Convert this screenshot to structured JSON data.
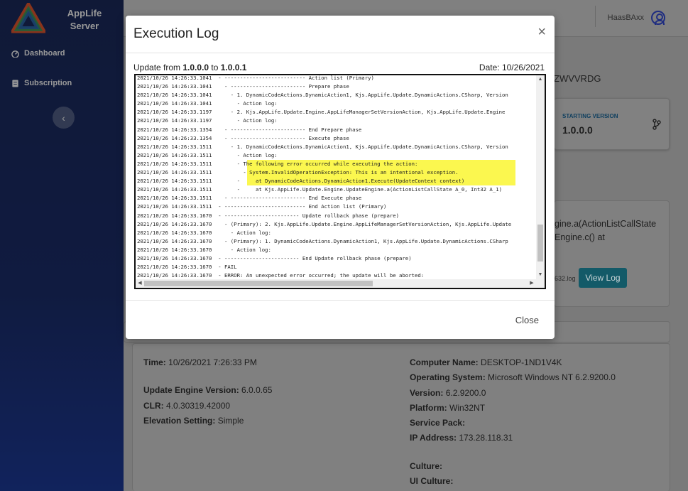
{
  "app": {
    "brand_line1": "AppLife",
    "brand_line2": "Server"
  },
  "sidebar": {
    "items": [
      {
        "label": "Dashboard",
        "icon": "dashboard-icon"
      },
      {
        "label": "Subscription",
        "icon": "subscription-icon"
      }
    ],
    "collapse_icon": "chevron-left-icon"
  },
  "header": {
    "user_name": "HaasBAxx",
    "user_icon": "user-circle-icon"
  },
  "background": {
    "id_partial": "ZWVVRDG",
    "starting_version_label": "STARTING VERSION",
    "starting_version_value": "1.0.0.0",
    "branch_icon": "branch-icon",
    "error_line1": "gine.a(ActionListCallState",
    "error_line2": "Engine.c() at",
    "log_file_partial": "632.log",
    "view_log_label": "View Log",
    "details_left": [
      {
        "key": "Time:",
        "value": "10/26/2021 7:26:33 PM"
      },
      {
        "key": "Update Engine Version:",
        "value": "6.0.0.65"
      },
      {
        "key": "CLR:",
        "value": "4.0.30319.42000"
      },
      {
        "key": "Elevation Setting:",
        "value": "Simple"
      }
    ],
    "details_right": [
      {
        "key": "Computer Name:",
        "value": "DESKTOP-1ND1V4K"
      },
      {
        "key": "Operating System:",
        "value": "Microsoft Windows NT 6.2.9200.0"
      },
      {
        "key": "Version:",
        "value": "6.2.9200.0"
      },
      {
        "key": "Platform:",
        "value": "Win32NT"
      },
      {
        "key": "Service Pack:",
        "value": ""
      },
      {
        "key": "IP Address:",
        "value": "173.28.118.31"
      },
      {
        "key": "Culture:",
        "value": ""
      },
      {
        "key": "UI Culture:",
        "value": ""
      }
    ]
  },
  "modal": {
    "title": "Execution Log",
    "close_icon": "close-icon",
    "update_prefix": "Update from ",
    "from_version": "1.0.0.0",
    "to_word": " to ",
    "to_version": "1.0.0.1",
    "date_text": "Date: 10/26/2021",
    "close_button_label": "Close",
    "highlight_color": "#fbf74f",
    "log_lines": [
      {
        "text": "2021/10/26 14:26:33.1041  - -------------------------- Action list (Primary)",
        "hl": false
      },
      {
        "text": "2021/10/26 14:26:33.1041    - ------------------------ Prepare phase",
        "hl": false
      },
      {
        "text": "2021/10/26 14:26:33.1041      - 1. DynamicCodeActions.DynamicAction1, Kjs.AppLife.Update.DynamicActions.CSharp, Version",
        "hl": false
      },
      {
        "text": "2021/10/26 14:26:33.1041        - Action log:",
        "hl": false
      },
      {
        "text": "2021/10/26 14:26:33.1197      - 2. Kjs.AppLife.Update.Engine.AppLifeManagerSetVersionAction, Kjs.AppLife.Update.Engine",
        "hl": false
      },
      {
        "text": "2021/10/26 14:26:33.1197        - Action log:",
        "hl": false
      },
      {
        "text": "2021/10/26 14:26:33.1354    - ------------------------ End Prepare phase",
        "hl": false
      },
      {
        "text": "2021/10/26 14:26:33.1354    - ------------------------ Execute phase",
        "hl": false
      },
      {
        "text": "2021/10/26 14:26:33.1511      - 1. DynamicCodeActions.DynamicAction1, Kjs.AppLife.Update.DynamicActions.CSharp, Version",
        "hl": false
      },
      {
        "text": "2021/10/26 14:26:33.1511        - Action log:",
        "hl": false
      },
      {
        "text": "2021/10/26 14:26:33.1511        - The following error occurred while executing the action:",
        "hl": true
      },
      {
        "text": "2021/10/26 14:26:33.1511          - System.InvalidOperationException: This is an intentional exception.",
        "hl": true
      },
      {
        "text": "2021/10/26 14:26:33.1511        -     at DynamicCodeActions.DynamicAction1.Execute(UpdateContext context)",
        "hl": true
      },
      {
        "text": "2021/10/26 14:26:33.1511        -     at Kjs.AppLife.Update.Engine.UpdateEngine.a(ActionListCallState A_0, Int32 A_1)",
        "hl": false
      },
      {
        "text": "2021/10/26 14:26:33.1511    - ------------------------ End Execute phase",
        "hl": false
      },
      {
        "text": "2021/10/26 14:26:33.1511  - -------------------------- End Action list (Primary)",
        "hl": false
      },
      {
        "text": "2021/10/26 14:26:33.1670  - ------------------------ Update rollback phase (prepare)",
        "hl": false
      },
      {
        "text": "2021/10/26 14:26:33.1670    - (Primary): 2. Kjs.AppLife.Update.Engine.AppLifeManagerSetVersionAction, Kjs.AppLife.Update",
        "hl": false
      },
      {
        "text": "2021/10/26 14:26:33.1670      - Action log:",
        "hl": false
      },
      {
        "text": "2021/10/26 14:26:33.1670    - (Primary): 1. DynamicCodeActions.DynamicAction1, Kjs.AppLife.Update.DynamicActions.CSharp",
        "hl": false
      },
      {
        "text": "2021/10/26 14:26:33.1670      - Action log:",
        "hl": false
      },
      {
        "text": "2021/10/26 14:26:33.1670  - ------------------------ End Update rollback phase (prepare)",
        "hl": false
      },
      {
        "text": "2021/10/26 14:26:33.1670  - FAIL",
        "hl": false
      },
      {
        "text": "2021/10/26 14:26:33.1670  - ERROR: An unexpected error occurred; the update will be aborted:",
        "hl": false
      }
    ],
    "scroll": {
      "up_arrow": "▲",
      "down_arrow": "▼",
      "left_arrow": "◀",
      "right_arrow": "▶"
    }
  }
}
